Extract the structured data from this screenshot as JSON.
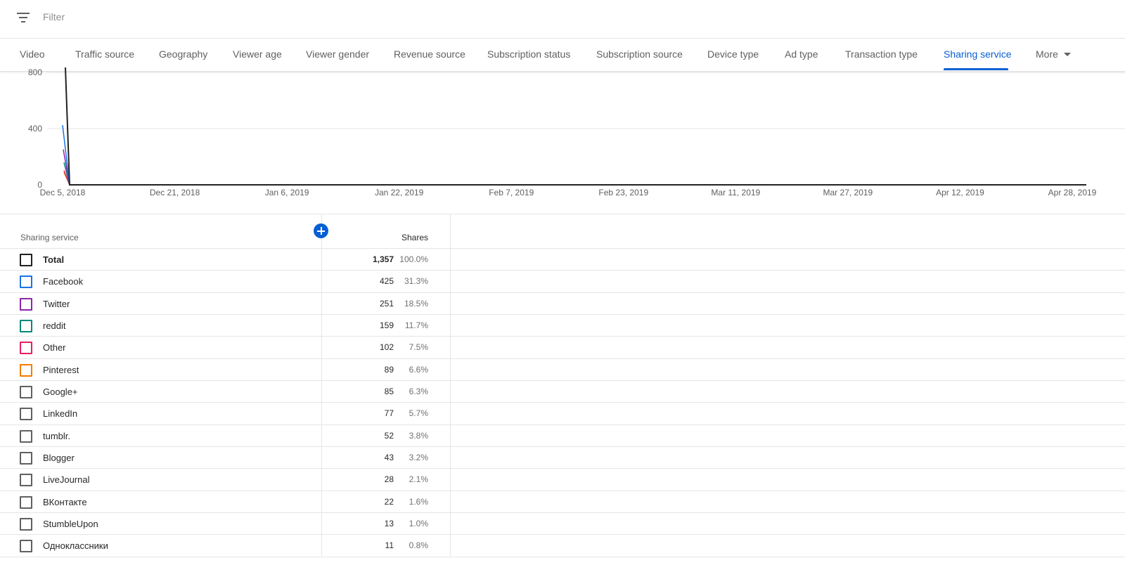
{
  "filter": {
    "placeholder": "Filter",
    "icon": "filter-icon"
  },
  "tabs": [
    {
      "label": "Video",
      "active": false
    },
    {
      "label": "Traffic source",
      "active": false
    },
    {
      "label": "Geography",
      "active": false
    },
    {
      "label": "Viewer age",
      "active": false
    },
    {
      "label": "Viewer gender",
      "active": false
    },
    {
      "label": "Revenue source",
      "active": false
    },
    {
      "label": "Subscription status",
      "active": false
    },
    {
      "label": "Subscription source",
      "active": false
    },
    {
      "label": "Device type",
      "active": false
    },
    {
      "label": "Ad type",
      "active": false
    },
    {
      "label": "Transaction type",
      "active": false
    },
    {
      "label": "Sharing service",
      "active": true
    },
    {
      "label": "More",
      "active": false
    }
  ],
  "chart_data": {
    "type": "line",
    "x_ticks": [
      "Dec 5, 2018",
      "Dec 21, 2018",
      "Jan 6, 2019",
      "Jan 22, 2019",
      "Feb 7, 2019",
      "Feb 23, 2019",
      "Mar 11, 2019",
      "Mar 27, 2019",
      "Apr 12, 2019",
      "Apr 28, 2019"
    ],
    "y_ticks": [
      0,
      400,
      800
    ],
    "ylim": [
      0,
      800
    ],
    "grid": true,
    "series": [
      {
        "name": "Total",
        "color": "#212121",
        "points": [
          [
            "Dec 5, 2018",
            1357
          ],
          [
            "Dec 6, 2018",
            0
          ],
          [
            "Apr 30, 2019",
            0
          ]
        ]
      },
      {
        "name": "Facebook",
        "color": "#1a73e8",
        "points": [
          [
            "Dec 5, 2018",
            425
          ],
          [
            "Dec 6, 2018",
            0
          ]
        ]
      },
      {
        "name": "Twitter",
        "color": "#8e24aa",
        "points": [
          [
            "Dec 5, 2018",
            251
          ],
          [
            "Dec 6, 2018",
            0
          ]
        ]
      },
      {
        "name": "reddit",
        "color": "#00897b",
        "points": [
          [
            "Dec 5, 2018",
            159
          ],
          [
            "Dec 6, 2018",
            0
          ]
        ]
      },
      {
        "name": "Other",
        "color": "#e91e63",
        "points": [
          [
            "Dec 5, 2018",
            102
          ],
          [
            "Dec 6, 2018",
            0
          ]
        ]
      },
      {
        "name": "Pinterest",
        "color": "#f57c00",
        "points": [
          [
            "Dec 5, 2018",
            89
          ],
          [
            "Dec 6, 2018",
            0
          ]
        ]
      }
    ]
  },
  "table": {
    "col_name": "Sharing service",
    "col_metric": "Shares",
    "rows": [
      {
        "name": "Total",
        "value": "1,357",
        "pct": "100.0%",
        "color": "#212121"
      },
      {
        "name": "Facebook",
        "value": "425",
        "pct": "31.3%",
        "color": "#1a73e8"
      },
      {
        "name": "Twitter",
        "value": "251",
        "pct": "18.5%",
        "color": "#8e24aa"
      },
      {
        "name": "reddit",
        "value": "159",
        "pct": "11.7%",
        "color": "#00897b"
      },
      {
        "name": "Other",
        "value": "102",
        "pct": "7.5%",
        "color": "#e91e63"
      },
      {
        "name": "Pinterest",
        "value": "89",
        "pct": "6.6%",
        "color": "#f57c00"
      },
      {
        "name": "Google+",
        "value": "85",
        "pct": "6.3%",
        "color": "#606060"
      },
      {
        "name": "LinkedIn",
        "value": "77",
        "pct": "5.7%",
        "color": "#606060"
      },
      {
        "name": "tumblr.",
        "value": "52",
        "pct": "3.8%",
        "color": "#606060"
      },
      {
        "name": "Blogger",
        "value": "43",
        "pct": "3.2%",
        "color": "#606060"
      },
      {
        "name": "LiveJournal",
        "value": "28",
        "pct": "2.1%",
        "color": "#606060"
      },
      {
        "name": "ВКонтакте",
        "value": "22",
        "pct": "1.6%",
        "color": "#606060"
      },
      {
        "name": "StumbleUpon",
        "value": "13",
        "pct": "1.0%",
        "color": "#606060"
      },
      {
        "name": "Одноклассники",
        "value": "11",
        "pct": "0.8%",
        "color": "#606060"
      }
    ]
  }
}
